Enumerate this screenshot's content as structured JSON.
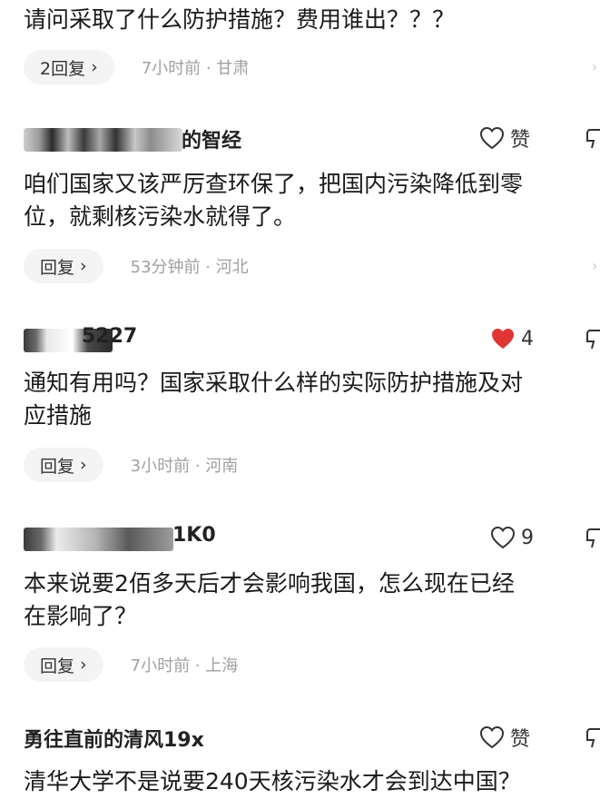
{
  "accent_color": "#e03535",
  "comments": [
    {
      "text_lines": [
        "请问采取了什么防护措施？费用谁出？？？"
      ],
      "reply_label": "2回复",
      "meta": "7小时前 · 甘肃"
    },
    {
      "username_visible": "的智经",
      "like_label": "赞",
      "liked": false,
      "text_lines": [
        "咱们国家又该严厉查环保了，把国内污染降低到零",
        "位，就剩核污染水就得了。"
      ],
      "reply_label": "回复",
      "meta": "53分钟前 · 河北"
    },
    {
      "username_visible": "5227",
      "like_label": "4",
      "liked": true,
      "text_lines": [
        "通知有用吗？国家采取什么样的实际防护措施及对",
        "应措施"
      ],
      "reply_label": "回复",
      "meta": "3小时前 · 河南"
    },
    {
      "username_visible": "1K0",
      "like_label": "9",
      "liked": false,
      "text_lines": [
        "本来说要2佰多天后才会影响我国，怎么现在已经",
        "在影响了？"
      ],
      "reply_label": "回复",
      "meta": "7小时前 · 上海"
    },
    {
      "username_visible": "勇往直前的清风19x",
      "like_label": "赞",
      "liked": false,
      "text_lines": [
        "清华大学不是说要240天核污染水才会到达中国？"
      ]
    }
  ]
}
